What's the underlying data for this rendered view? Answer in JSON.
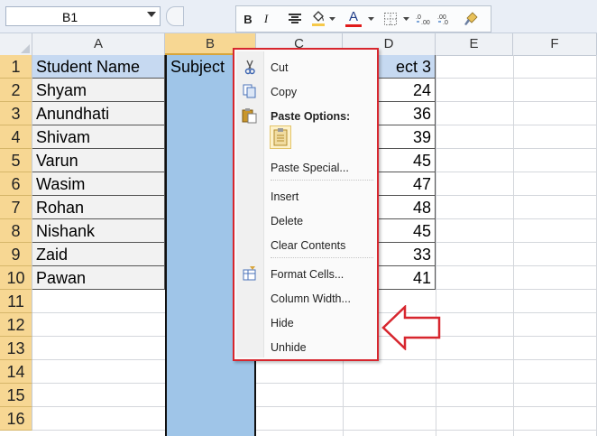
{
  "namebox": {
    "value": "B1"
  },
  "columns": [
    "A",
    "B",
    "C",
    "D",
    "E",
    "F"
  ],
  "rows": [
    "1",
    "2",
    "3",
    "4",
    "5",
    "6",
    "7",
    "8",
    "9",
    "10",
    "11",
    "12",
    "13",
    "14",
    "15",
    "16"
  ],
  "table": {
    "header_a": "Student Name",
    "header_b": "Subject",
    "header_d": "ect 3",
    "names": [
      "Shyam",
      "Anundhati",
      "Shivam",
      "Varun",
      "Wasim",
      "Rohan",
      "Nishank",
      "Zaid",
      "Pawan"
    ],
    "subject3": [
      "24",
      "36",
      "39",
      "45",
      "47",
      "48",
      "45",
      "33",
      "41"
    ]
  },
  "mini_toolbar": {
    "bold": "B",
    "italic": "I",
    "font_color_label": "A",
    "align_icon": "align-center-icon",
    "fill_icon": "fill-color-icon",
    "borders_icon": "borders-icon",
    "increase_decimal_icon": "increase-decimal-icon",
    "decrease_decimal_icon": "decrease-decimal-icon",
    "format_painter_icon": "format-painter-icon"
  },
  "context_menu": {
    "cut": "Cut",
    "copy": "Copy",
    "paste_options": "Paste Options:",
    "paste_special": "Paste Special...",
    "insert": "Insert",
    "delete": "Delete",
    "clear_contents": "Clear Contents",
    "format_cells": "Format Cells...",
    "column_width": "Column Width...",
    "hide": "Hide",
    "unhide": "Unhide"
  },
  "colors": {
    "highlight": "#d7262e",
    "selection": "#9fc5e8",
    "header_fill": "#c6d9f1",
    "row_header_selected": "#f7d793"
  }
}
